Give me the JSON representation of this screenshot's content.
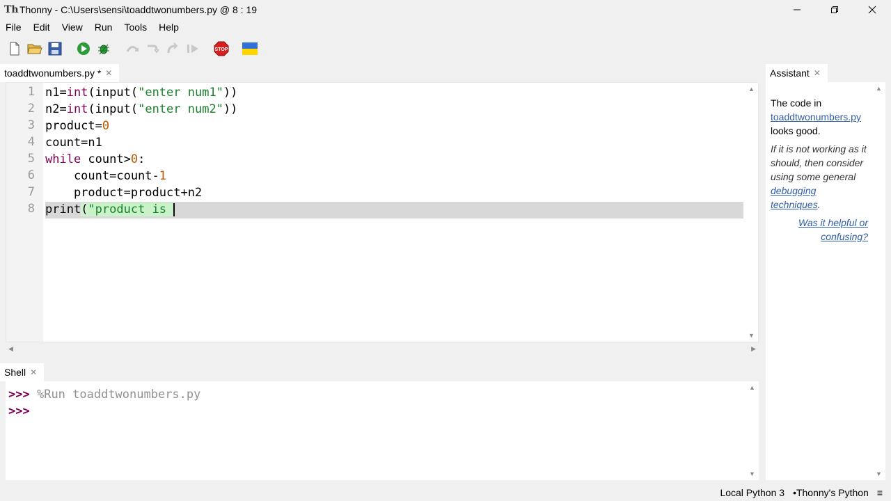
{
  "window": {
    "app_name": "Thonny",
    "title": "Thonny  -  C:\\Users\\sensi\\toaddtwonumbers.py  @  8 : 19"
  },
  "menu": [
    "File",
    "Edit",
    "View",
    "Run",
    "Tools",
    "Help"
  ],
  "toolbar": {
    "icons": [
      "new-file-icon",
      "open-file-icon",
      "save-icon",
      "run-icon",
      "debug-icon",
      "step-over-icon",
      "step-into-icon",
      "step-out-icon",
      "resume-icon",
      "stop-icon",
      "ukraine-flag-icon"
    ],
    "stop_label": "STOP"
  },
  "editor": {
    "tab_label": "toaddtwonumbers.py *",
    "line_numbers": [
      "1",
      "2",
      "3",
      "4",
      "5",
      "6",
      "7",
      "8"
    ]
  },
  "shell": {
    "tab_label": "Shell",
    "prompt": ">>>",
    "command": "%Run toaddtwonumbers.py"
  },
  "assistant": {
    "tab_label": "Assistant",
    "line1_prefix": "The code in",
    "file_link": "toaddtwonumbers.py",
    "line1_suffix": "looks good.",
    "advice_prefix": "If it is not working as it should, then consider using some general",
    "advice_link": "debugging techniques",
    "advice_suffix": ".",
    "feedback": "Was it helpful or confusing?"
  },
  "status": {
    "interpreter": "Local Python 3",
    "separator": "•",
    "backend": "Thonny's Python"
  },
  "colors": {
    "keyword": "#7f0055",
    "string": "#1a7f2a",
    "number": "#b75a00",
    "link": "#2f5ea8",
    "current_line": "#d8d8d8"
  }
}
